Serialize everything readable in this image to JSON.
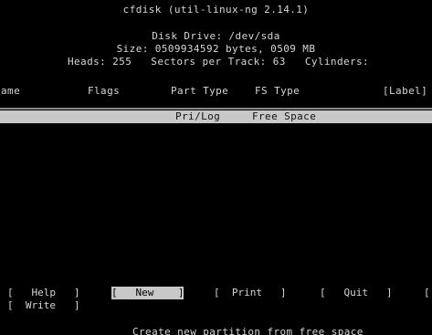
{
  "window": {
    "title": "cfdisk (util-linux-ng 2.14.1)"
  },
  "disk": {
    "drive_line": "Disk Drive: /dev/sda",
    "size_line": "Size: 0509934592 bytes, 0509 MB",
    "geometry_line": "Heads: 255   Sectors per Track: 63   Cylinders: "
  },
  "table": {
    "columns": {
      "name": "Name",
      "flags": "Flags",
      "part_type": "Part Type",
      "fs_type": "FS Type",
      "label": "[Label]"
    },
    "free_row": {
      "part_type": "Pri/Log",
      "fs_type": "Free Space"
    }
  },
  "menu": {
    "help": "[   Help   ]",
    "new": "[   New    ]",
    "print": "[  Print   ]",
    "quit": "[   Quit   ]",
    "tail": "[",
    "write": "[  Write   ]",
    "selected": "new"
  },
  "status": {
    "message": "Create new partition from free space"
  },
  "colors": {
    "background": "#000000",
    "text": "#d6d6d6",
    "highlight": "#c8c8c8"
  }
}
